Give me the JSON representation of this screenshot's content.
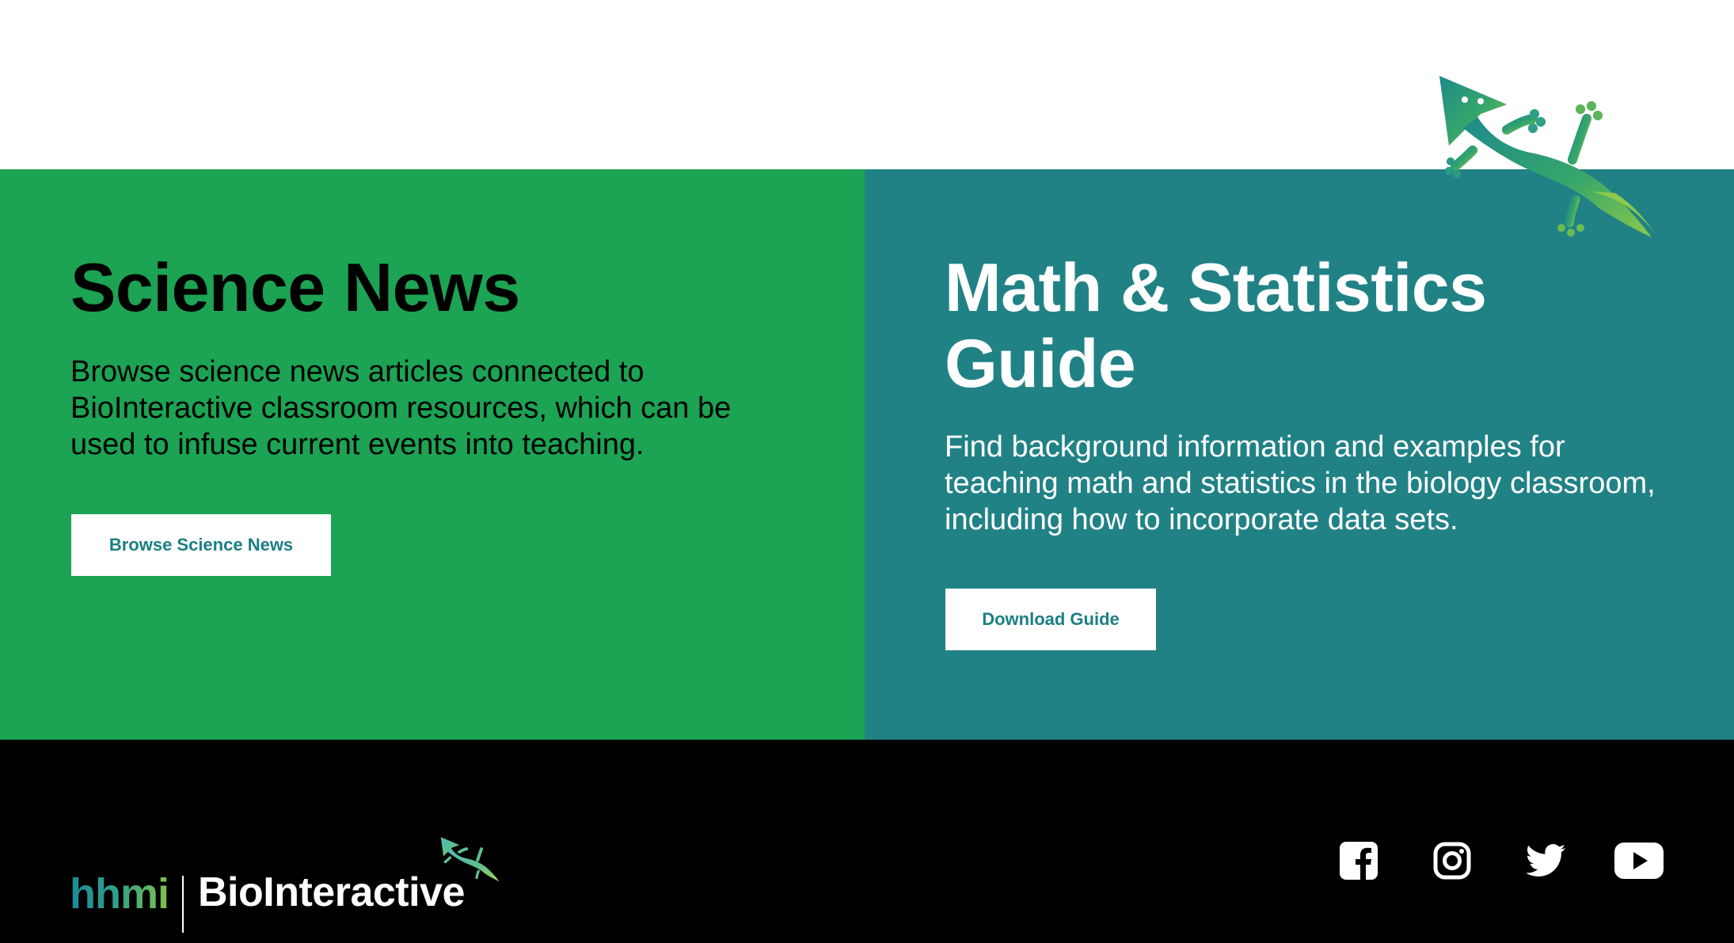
{
  "panels": {
    "science_news": {
      "title": "Science News",
      "description": "Browse science news articles connected to BioInteractive classroom resources, which can be used to infuse current events into teaching.",
      "button_label": "Browse Science News",
      "background_color": "#1ca353"
    },
    "math_stats": {
      "title": "Math & Statistics Guide",
      "description": "Find background information and examples for teaching math and statistics in the biology classroom, including how to incorporate data sets.",
      "button_label": "Download Guide",
      "background_color": "#218286"
    }
  },
  "mascot": {
    "icon": "gecko-icon"
  },
  "footer": {
    "background_color": "#000000",
    "logo": {
      "org": "hhmi",
      "brand": "BioInteractive",
      "icon": "gecko-icon"
    },
    "social": [
      {
        "name": "facebook",
        "icon": "facebook-icon"
      },
      {
        "name": "instagram",
        "icon": "instagram-icon"
      },
      {
        "name": "twitter",
        "icon": "twitter-icon"
      },
      {
        "name": "youtube",
        "icon": "youtube-icon"
      }
    ]
  },
  "colors": {
    "button_text": "#1b7f84",
    "accent_green": "#1ca353",
    "accent_teal": "#218286"
  }
}
